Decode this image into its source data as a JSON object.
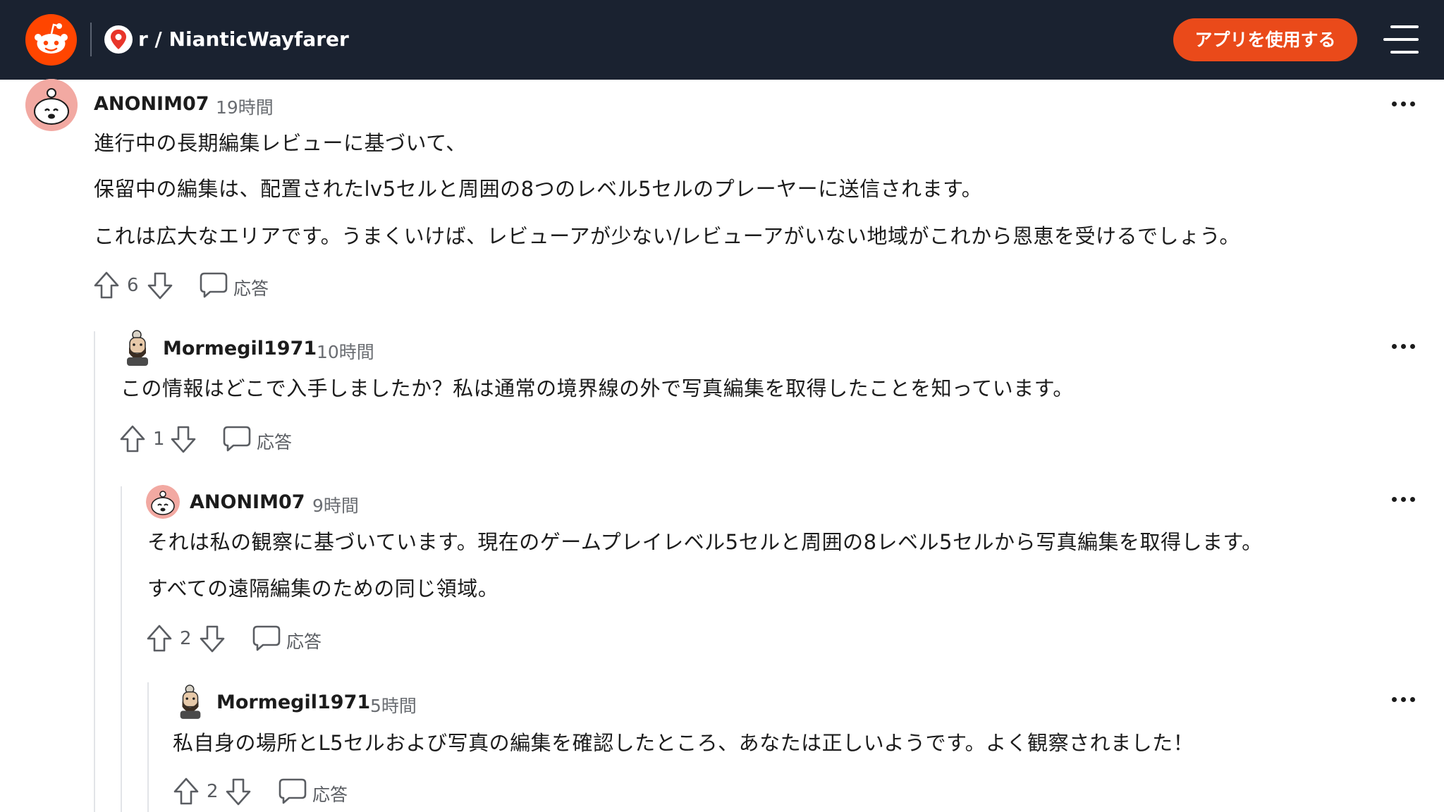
{
  "header": {
    "subreddit": "r / NianticWayfarer",
    "app_button": "アプリを使用する"
  },
  "comments": [
    {
      "username": "ANONIM07",
      "time": "19時間",
      "paragraphs": [
        "進行中の長期編集レビューに基づいて、",
        "保留中の編集は、配置されたlv5セルと周囲の8つのレベル5セルのプレーヤーに送信されます。",
        "これは広大なエリアです。うまくいけば、レビューアが少ない/レビューアがいない地域がこれから恩恵を受けるでしょう。"
      ],
      "votes": "6",
      "reply": "応答"
    },
    {
      "username": "Mormegil1971",
      "time": "10時間",
      "paragraphs": [
        "この情報はどこで入手しましたか？私は通常の境界線の外で写真編集を取得したことを知っています。"
      ],
      "votes": "1",
      "reply": "応答"
    },
    {
      "username": "ANONIM07",
      "time": "9時間",
      "paragraphs": [
        "それは私の観察に基づいています。現在のゲームプレイレベル5セルと周囲の8レベル5セルから写真編集を取得します。",
        "すべての遠隔編集のための同じ領域。"
      ],
      "votes": "2",
      "reply": "応答"
    },
    {
      "username": "Mormegil1971",
      "time": "5時間",
      "paragraphs": [
        "私自身の場所とL5セルおよび写真の編集を確認したところ、あなたは正しいようです。よく観察されました！"
      ],
      "votes": "2",
      "reply": "応答"
    }
  ],
  "colors": {
    "header_bg": "#1a2230",
    "brand_orange": "#ff4500",
    "app_button": "#ea4a1a"
  },
  "icons": [
    "reddit-logo-icon",
    "map-pin-icon",
    "hamburger-menu-icon",
    "more-options-icon",
    "upvote-icon",
    "downvote-icon",
    "reply-bubble-icon",
    "snoo-avatar-icon",
    "bearded-avatar-icon"
  ]
}
